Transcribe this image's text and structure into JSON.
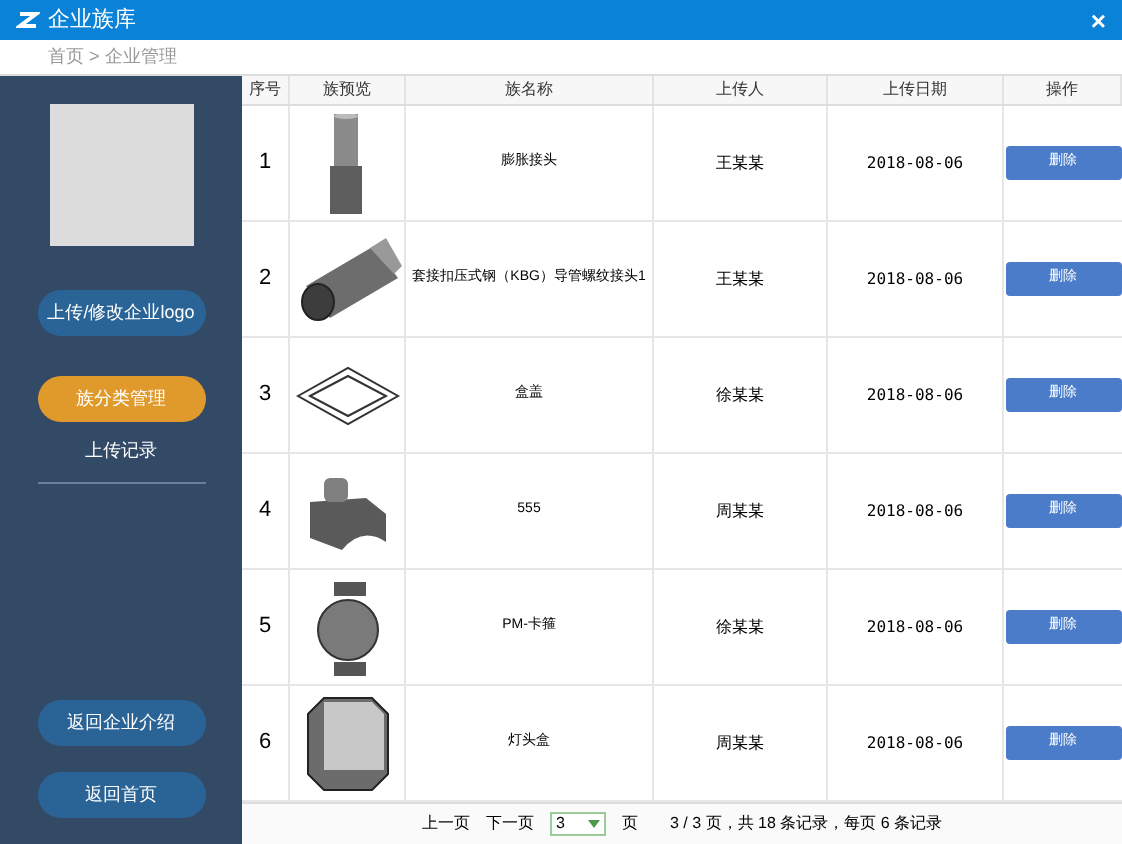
{
  "window": {
    "title": "企业族库",
    "close": "×"
  },
  "breadcrumb": "首页 > 企业管理",
  "sidebar": {
    "buttons": [
      {
        "label": "上传/修改企业logo",
        "kind": "blue"
      },
      {
        "label": "族分类管理",
        "kind": "orange"
      }
    ],
    "section": "上传记录",
    "bottom_buttons": [
      "返回企业介绍",
      "返回首页"
    ]
  },
  "table": {
    "columns": [
      "序号",
      "族预览",
      "族名称",
      "上传人",
      "上传日期",
      "操作"
    ],
    "rows": [
      {
        "index": "1",
        "preview": {
          "kind": "pipe"
        },
        "name": "膨胀接头",
        "uploader": "王某某",
        "date": "2018-08-06",
        "action": "删除"
      },
      {
        "index": "2",
        "preview": {
          "kind": "tube"
        },
        "name": "套接扣压式钢（KBG）导管螺纹接头1",
        "uploader": "王某某",
        "date": "2018-08-06",
        "action": "删除"
      },
      {
        "index": "3",
        "preview": {
          "kind": "plate"
        },
        "name": "盒盖",
        "uploader": "徐某某",
        "date": "2018-08-06",
        "action": "删除"
      },
      {
        "index": "4",
        "preview": {
          "kind": "block"
        },
        "name": "555",
        "uploader": "周某某",
        "date": "2018-08-06",
        "action": "删除"
      },
      {
        "index": "5",
        "preview": {
          "kind": "clamp"
        },
        "name": "PM-卡箍",
        "uploader": "徐某某",
        "date": "2018-08-06",
        "action": "删除"
      },
      {
        "index": "6",
        "preview": {
          "kind": "box"
        },
        "name": "灯头盒",
        "uploader": "周某某",
        "date": "2018-08-06",
        "action": "删除"
      }
    ]
  },
  "pagination": {
    "prev": "上一页",
    "next": "下一页",
    "page": "3",
    "page_unit": "页",
    "summary": "3 / 3 页，共 18 条记录，每页 6 条记录"
  }
}
